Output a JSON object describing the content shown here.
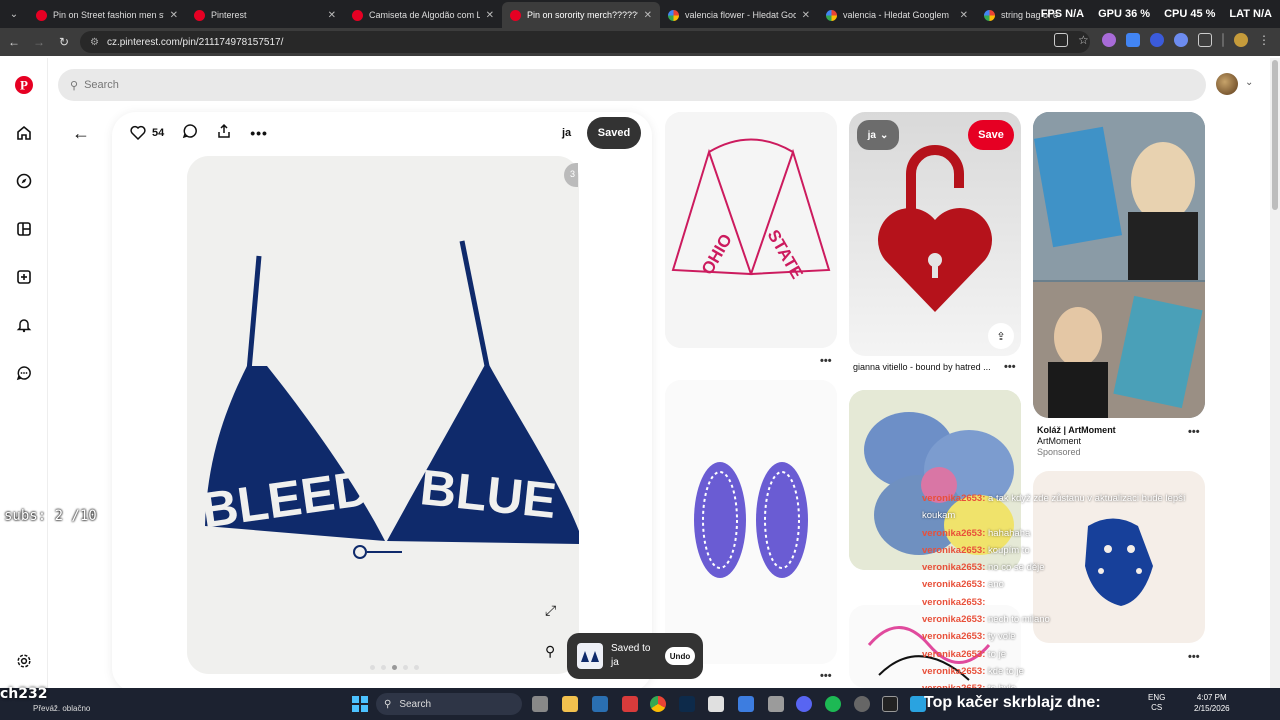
{
  "browser": {
    "tabs": [
      {
        "label": "Pin on Street fashion men stree",
        "icon": "pinterest-icon"
      },
      {
        "label": "Pinterest",
        "icon": "pinterest-icon"
      },
      {
        "label": "Camiseta de Algodão com Log",
        "icon": "pinterest-icon"
      },
      {
        "label": "Pin on sorority merch??????",
        "icon": "pinterest-icon"
      },
      {
        "label": "valencia flower - Hledat Google",
        "icon": "google-icon"
      },
      {
        "label": "valencia - Hledat Googlem",
        "icon": "google-icon"
      },
      {
        "label": "string bag of oranges - Hledat",
        "icon": "google-icon"
      }
    ],
    "url": "cz.pinterest.com/pin/211174978157517/",
    "perf": {
      "fps": "FPS N/A",
      "gpu": "GPU 36 %",
      "cpu": "CPU 45 %",
      "lat": "LAT N/A"
    }
  },
  "pinterest": {
    "search_placeholder": "Search",
    "pin": {
      "likes": "54",
      "board_name": "ja",
      "saved_label": "Saved",
      "image_left_text": "BLEED",
      "image_right_text": "BLUE",
      "counter": "3"
    },
    "grid": {
      "card1_text_left": "OHIO",
      "card1_text_right": "STATE",
      "card2_board_label": "ja",
      "card2_save_label": "Save",
      "card2_caption": "gianna vitiello - bound by hatred ...",
      "card3_title": "Koláž | ArtMoment",
      "card3_subtitle": "ArtMoment",
      "card3_sponsored": "Sponsored"
    },
    "toast": {
      "line1": "Saved to",
      "line2": "ja",
      "undo_label": "Undo"
    }
  },
  "overlay": {
    "subs": "subs: 2 /10",
    "channel": "ch232",
    "chat": [
      {
        "user": "veronika2653:",
        "message": "a tak když zde zůstanu v aktualizaci bude lepší"
      },
      {
        "user": "",
        "message": "koukam"
      },
      {
        "user": "veronika2653:",
        "message": "hahahaha"
      },
      {
        "user": "veronika2653:",
        "message": "koupím to"
      },
      {
        "user": "veronika2653:",
        "message": "no co se děje"
      },
      {
        "user": "veronika2653:",
        "message": "ano"
      },
      {
        "user": "veronika2653:",
        "message": ""
      },
      {
        "user": "veronika2653:",
        "message": "nech to milano"
      },
      {
        "user": "veronika2653:",
        "message": "ty vole"
      },
      {
        "user": "veronika2653:",
        "message": "to je"
      },
      {
        "user": "veronika2653:",
        "message": "kde to je"
      },
      {
        "user": "veronika2653:",
        "message": "to bylo"
      }
    ]
  },
  "taskbar": {
    "weather": "Převáž. oblačno",
    "search_label": "Search",
    "ticker": "Top kačer skrblajz dne:",
    "lang_top": "ENG",
    "lang_bottom": "CS",
    "time": "4:07 PM",
    "date": "2/15/2026"
  },
  "colors": {
    "accent": "#e60023",
    "dark_button": "#333333",
    "navy": "#0f2a6b",
    "chat_user": "#e8503a"
  }
}
